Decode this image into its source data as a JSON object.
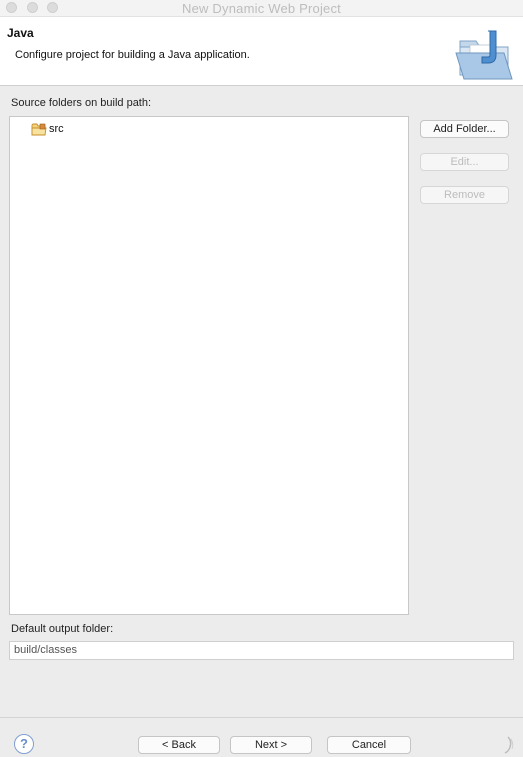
{
  "window": {
    "title": "New Dynamic Web Project"
  },
  "header": {
    "title": "Java",
    "description": "Configure project for building a Java application.",
    "icon": "java-folder-wizard-icon"
  },
  "source_folders": {
    "label": "Source folders on build path:",
    "items": [
      {
        "label": "src",
        "icon": "package-folder-icon"
      }
    ],
    "buttons": {
      "add_folder": "Add Folder...",
      "edit": "Edit...",
      "remove": "Remove"
    }
  },
  "output": {
    "label": "Default output folder:",
    "value": "build/classes"
  },
  "footer": {
    "help": "?",
    "back": "< Back",
    "next": "Next >",
    "cancel": "Cancel"
  },
  "colors": {
    "accent": "#6a8fcb",
    "folder": "#e8b04a"
  }
}
